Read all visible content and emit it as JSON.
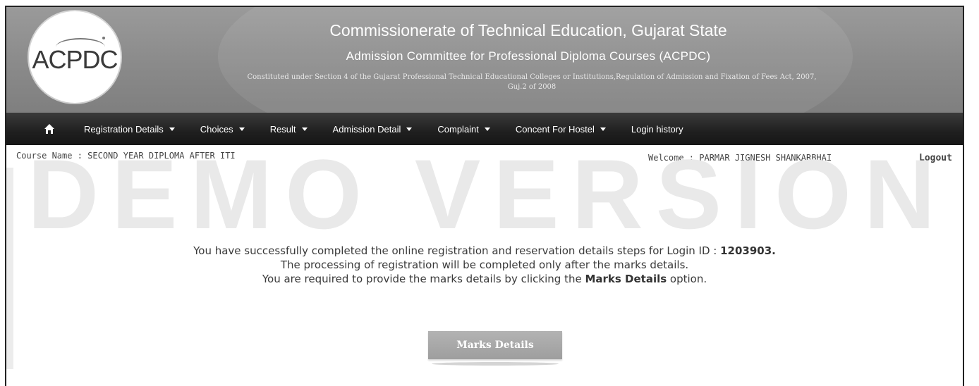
{
  "header": {
    "logo_text": "ACPDC",
    "title": "Commissionerate of Technical Education, Gujarat State",
    "subtitle": "Admission Committee for Professional Diploma Courses (ACPDC)",
    "constitution_line1": "Constituted under Section 4 of the Gujarat Professional Technical Educational Colleges or Institutions,Regulation of Admission and Fixation of Fees Act, 2007,",
    "constitution_line2": "Guj.2 of 2008"
  },
  "nav": {
    "items": [
      {
        "label": "Registration Details",
        "has_dropdown": true
      },
      {
        "label": "Choices",
        "has_dropdown": true
      },
      {
        "label": "Result",
        "has_dropdown": true
      },
      {
        "label": "Admission Detail",
        "has_dropdown": true
      },
      {
        "label": "Complaint",
        "has_dropdown": true
      },
      {
        "label": "Concent For Hostel",
        "has_dropdown": true
      },
      {
        "label": "Login history",
        "has_dropdown": false
      }
    ]
  },
  "infobar": {
    "course": "Course Name : SECOND YEAR DIPLOMA AFTER ITI",
    "welcome": "Welcome : PARMAR JIGNESH SHANKARBHAI",
    "logout": "Logout"
  },
  "watermark": "DEMO VERSION",
  "message": {
    "line1_prefix": "You have successfully completed the online registration and reservation details steps for Login ID : ",
    "login_id": "1203903.",
    "line2": "The processing of registration will be completed only after the marks details.",
    "line3_prefix": "You are required to provide the marks details by clicking the ",
    "line3_bold": "Marks Details",
    "line3_suffix": " option."
  },
  "button": {
    "label": "Marks Details"
  },
  "colors": {
    "header_bg": "#8a8a8a",
    "nav_bg": "#1f1f1f",
    "button_bg": "#a8a8a8"
  }
}
